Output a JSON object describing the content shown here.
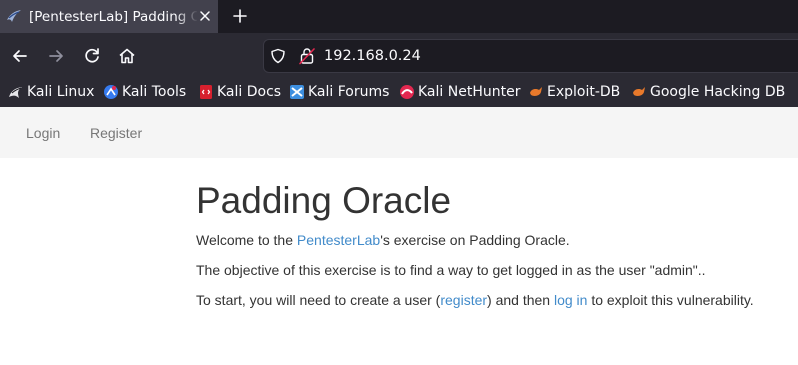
{
  "browser": {
    "tab": {
      "title": "[PentesterLab] Padding Oracle",
      "favicon": "kali-dragon-icon",
      "close": "close-icon"
    },
    "new_tab": "plus-icon",
    "nav": {
      "back": "arrow-left-icon",
      "forward": "arrow-right-icon",
      "reload": "reload-icon",
      "home": "home-icon"
    },
    "address": {
      "url": "192.168.0.24",
      "tracking_icon": "shield-icon",
      "security_icon": "insecure-lock-icon"
    },
    "bookmarks": [
      {
        "label": "Kali Linux",
        "icon": "kali-dragon-icon"
      },
      {
        "label": "Kali Tools",
        "icon": "kali-tools-icon"
      },
      {
        "label": "Kali Docs",
        "icon": "kali-docs-icon"
      },
      {
        "label": "Kali Forums",
        "icon": "kali-forums-icon"
      },
      {
        "label": "Kali NetHunter",
        "icon": "nethunter-icon"
      },
      {
        "label": "Exploit-DB",
        "icon": "exploit-db-icon"
      },
      {
        "label": "Google Hacking DB",
        "icon": "ghdb-icon"
      }
    ],
    "colors": {
      "tabstrip": "#1c1b22",
      "toolbar": "#2b2a33",
      "active_tab": "#42414d"
    }
  },
  "site": {
    "nav": {
      "login": "Login",
      "register": "Register"
    },
    "heading": "Padding Oracle",
    "welcome": {
      "prefix": "Welcome to the ",
      "link": "PentesterLab",
      "suffix": "'s exercise on Padding Oracle."
    },
    "objective": "The objective of this exercise is to find a way to get logged in as the user \"admin\"..",
    "start": {
      "part1": "To start, you will need to create a user (",
      "register_link": "register",
      "part2": ") and then ",
      "login_link": "log in",
      "part3": " to exploit this vulnerability."
    },
    "colors": {
      "link": "#428bca",
      "text": "#333333",
      "navbar_bg": "#f5f5f5"
    }
  }
}
